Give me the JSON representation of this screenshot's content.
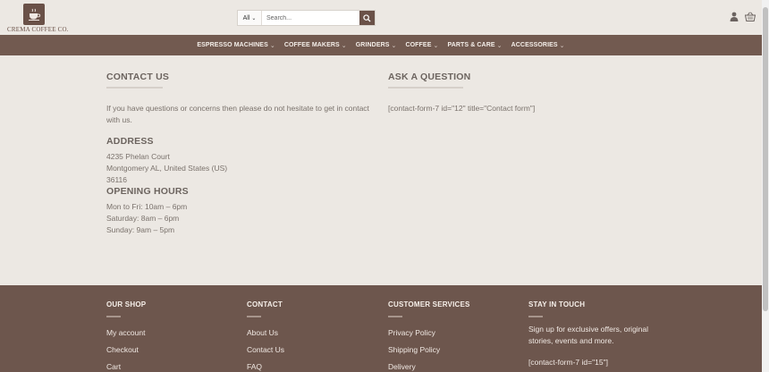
{
  "brand": {
    "logo_text": "CREMA COFFEE CO."
  },
  "search": {
    "category": "All",
    "placeholder": "Search..."
  },
  "icons": {
    "account": "user-icon",
    "cart": "cart-icon",
    "search": "search-icon"
  },
  "nav": {
    "items": [
      "ESPRESSO MACHINES",
      "COFFEE MAKERS",
      "GRINDERS",
      "COFFEE",
      "PARTS & CARE",
      "ACCESSORIES"
    ]
  },
  "contact": {
    "title": "CONTACT US",
    "intro_line1": "If you have questions or concerns then please do not hesitate to get in contact",
    "intro_line2": "with us."
  },
  "address": {
    "title": "ADDRESS",
    "line1": "4235 Phelan Court",
    "line2": "Montgomery AL, United States (US)",
    "line3": "36116"
  },
  "hours": {
    "title": "OPENING HOURS",
    "line1": "Mon to Fri: 10am – 6pm",
    "line2": "Saturday: 8am – 6pm",
    "line3": "Sunday: 9am – 5pm"
  },
  "question": {
    "title": "ASK A QUESTION",
    "shortcode": "[contact-form-7 id=\"12\" title=\"Contact form\"]"
  },
  "footer": {
    "shop": {
      "title": "OUR SHOP",
      "links": [
        "My account",
        "Checkout",
        "Cart"
      ]
    },
    "contact": {
      "title": "CONTACT",
      "links": [
        "About Us",
        "Contact Us",
        "FAQ"
      ]
    },
    "services": {
      "title": "CUSTOMER SERVICES",
      "links": [
        "Privacy Policy",
        "Shipping Policy",
        "Delivery"
      ]
    },
    "stay": {
      "title": "STAY IN TOUCH",
      "line1": "Sign up for exclusive offers, original",
      "line2": "stories, events and more.",
      "shortcode": "[contact-form-7 id=\"15\"]"
    }
  },
  "colors": {
    "brand": "#6d564d",
    "nav": "#725a50",
    "background": "#ece8e3"
  }
}
